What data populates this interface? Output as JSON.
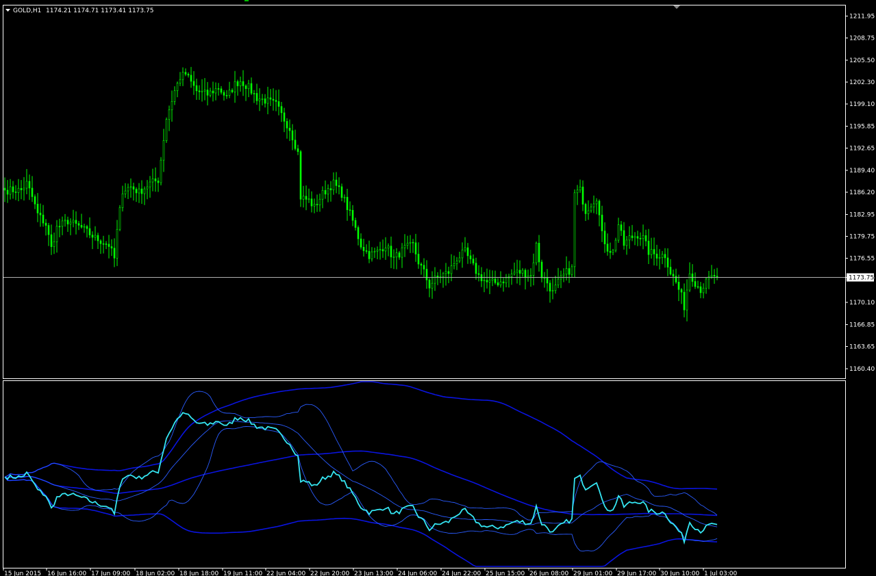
{
  "header": {
    "symbol": "GOLD,H1",
    "ohlc": "1174.21 1174.71 1173.41 1173.75"
  },
  "colors": {
    "background": "#000000",
    "candle": "#00ff00",
    "border": "#ffffff",
    "price_line": "#b0b0b0",
    "indicator_main": "#35e6f3",
    "indicator_inner_band": "#2a5cff",
    "indicator_outer_band": "#0a14e0"
  },
  "chart_data": {
    "type": "candlestick",
    "timeframe": "H1",
    "ylim": [
      1158.8,
      1213.6
    ],
    "y_ticks": [
      "1211.95",
      "1208.75",
      "1205.50",
      "1202.30",
      "1199.10",
      "1195.85",
      "1192.65",
      "1189.40",
      "1186.20",
      "1182.95",
      "1179.75",
      "1176.55",
      "1173.75",
      "1170.10",
      "1166.85",
      "1163.65",
      "1160.40"
    ],
    "current_price": "1173.75",
    "x_ticks": [
      "15 Jun 2015",
      "16 Jun 16:00",
      "17 Jun 09:00",
      "18 Jun 02:00",
      "18 Jun 18:00",
      "19 Jun 11:00",
      "22 Jun 04:00",
      "22 Jun 20:00",
      "23 Jun 13:00",
      "24 Jun 06:00",
      "24 Jun 22:00",
      "25 Jun 15:00",
      "26 Jun 08:00",
      "29 Jun 01:00",
      "29 Jun 17:00",
      "30 Jun 10:00",
      "1 Jul 03:00"
    ],
    "close_anchors": [
      [
        0,
        1186.5
      ],
      [
        6,
        1186.5
      ],
      [
        8,
        1187.5
      ],
      [
        10,
        1185.5
      ],
      [
        12,
        1183.0
      ],
      [
        15,
        1181.5
      ],
      [
        17,
        1178.0
      ],
      [
        19,
        1181.0
      ],
      [
        23,
        1182.0
      ],
      [
        28,
        1181.0
      ],
      [
        33,
        1179.5
      ],
      [
        38,
        1178.5
      ],
      [
        40,
        1176.5
      ],
      [
        41,
        1180.5
      ],
      [
        43,
        1186.5
      ],
      [
        46,
        1187.0
      ],
      [
        49,
        1186.2
      ],
      [
        53,
        1187.5
      ],
      [
        56,
        1188.0
      ],
      [
        59,
        1197.0
      ],
      [
        62,
        1201.0
      ],
      [
        64,
        1203.0
      ],
      [
        66,
        1203.5
      ],
      [
        70,
        1201.0
      ],
      [
        74,
        1200.5
      ],
      [
        78,
        1201.5
      ],
      [
        81,
        1200.0
      ],
      [
        84,
        1202.0
      ],
      [
        86,
        1202.5
      ],
      [
        89,
        1201.5
      ],
      [
        92,
        1200.0
      ],
      [
        96,
        1199.5
      ],
      [
        99,
        1199.0
      ],
      [
        101,
        1197.5
      ],
      [
        104,
        1195.5
      ],
      [
        107,
        1192.0
      ],
      [
        108,
        1185.5
      ],
      [
        111,
        1185.0
      ],
      [
        113,
        1184.0
      ],
      [
        116,
        1186.0
      ],
      [
        120,
        1187.5
      ],
      [
        123,
        1186.0
      ],
      [
        125,
        1184.0
      ],
      [
        127,
        1182.0
      ],
      [
        130,
        1178.5
      ],
      [
        133,
        1177.0
      ],
      [
        136,
        1177.5
      ],
      [
        139,
        1178.5
      ],
      [
        142,
        1176.5
      ],
      [
        146,
        1178.0
      ],
      [
        149,
        1178.5
      ],
      [
        151,
        1176.0
      ],
      [
        153,
        1174.5
      ],
      [
        155,
        1172.5
      ],
      [
        157,
        1173.5
      ],
      [
        159,
        1174.0
      ],
      [
        162,
        1174.5
      ],
      [
        165,
        1176.5
      ],
      [
        168,
        1177.5
      ],
      [
        170,
        1176.0
      ],
      [
        173,
        1174.0
      ],
      [
        176,
        1173.0
      ],
      [
        180,
        1173.0
      ],
      [
        183,
        1173.5
      ],
      [
        186,
        1174.5
      ],
      [
        189,
        1174.5
      ],
      [
        192,
        1174.0
      ],
      [
        194,
        1178.5
      ],
      [
        196,
        1174.0
      ],
      [
        198,
        1173.0
      ],
      [
        200,
        1171.5
      ],
      [
        202,
        1173.0
      ],
      [
        205,
        1174.5
      ],
      [
        207,
        1175.0
      ],
      [
        208,
        1186.0
      ],
      [
        210,
        1186.5
      ],
      [
        212,
        1183.5
      ],
      [
        214,
        1184.5
      ],
      [
        216,
        1185.5
      ],
      [
        218,
        1180.0
      ],
      [
        220,
        1178.0
      ],
      [
        222,
        1177.5
      ],
      [
        224,
        1181.5
      ],
      [
        226,
        1178.5
      ],
      [
        228,
        1179.5
      ],
      [
        231,
        1180.0
      ],
      [
        233,
        1179.5
      ],
      [
        235,
        1177.5
      ],
      [
        238,
        1177.0
      ],
      [
        241,
        1177.0
      ],
      [
        243,
        1174.5
      ],
      [
        245,
        1173.0
      ],
      [
        247,
        1171.0
      ],
      [
        248,
        1169.5
      ],
      [
        250,
        1174.5
      ],
      [
        252,
        1173.0
      ],
      [
        254,
        1172.0
      ],
      [
        257,
        1173.5
      ],
      [
        259,
        1174.0
      ],
      [
        260,
        1173.75
      ]
    ],
    "oscillator": {
      "series": [
        {
          "name": "",
          "role": "main"
        },
        {
          "name": "",
          "role": "upper_band"
        },
        {
          "name": "",
          "role": "lower_band"
        },
        {
          "name": "",
          "role": "slow_upper"
        },
        {
          "name": "",
          "role": "slow_middle"
        },
        {
          "name": "",
          "role": "slow_lower"
        }
      ]
    }
  }
}
